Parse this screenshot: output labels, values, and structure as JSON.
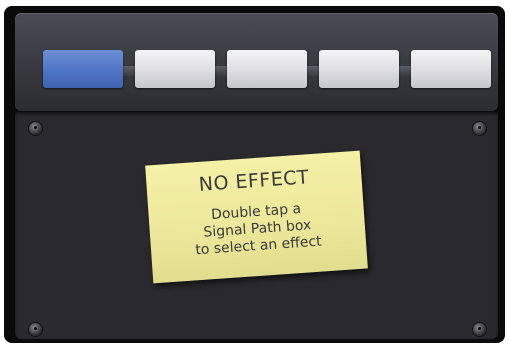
{
  "signal_path": {
    "slots": [
      {
        "label": "",
        "selected": true
      },
      {
        "label": "",
        "selected": false
      },
      {
        "label": "",
        "selected": false
      },
      {
        "label": "",
        "selected": false
      },
      {
        "label": "",
        "selected": false
      }
    ]
  },
  "note": {
    "title": "NO EFFECT",
    "message": "Double tap a\nSignal Path box\nto select an effect"
  },
  "colors": {
    "selected_slot": "#4f74c4",
    "note_background": "#ece79a",
    "panel_background": "#2a2a2e"
  },
  "icons": [
    "screw-icon"
  ]
}
